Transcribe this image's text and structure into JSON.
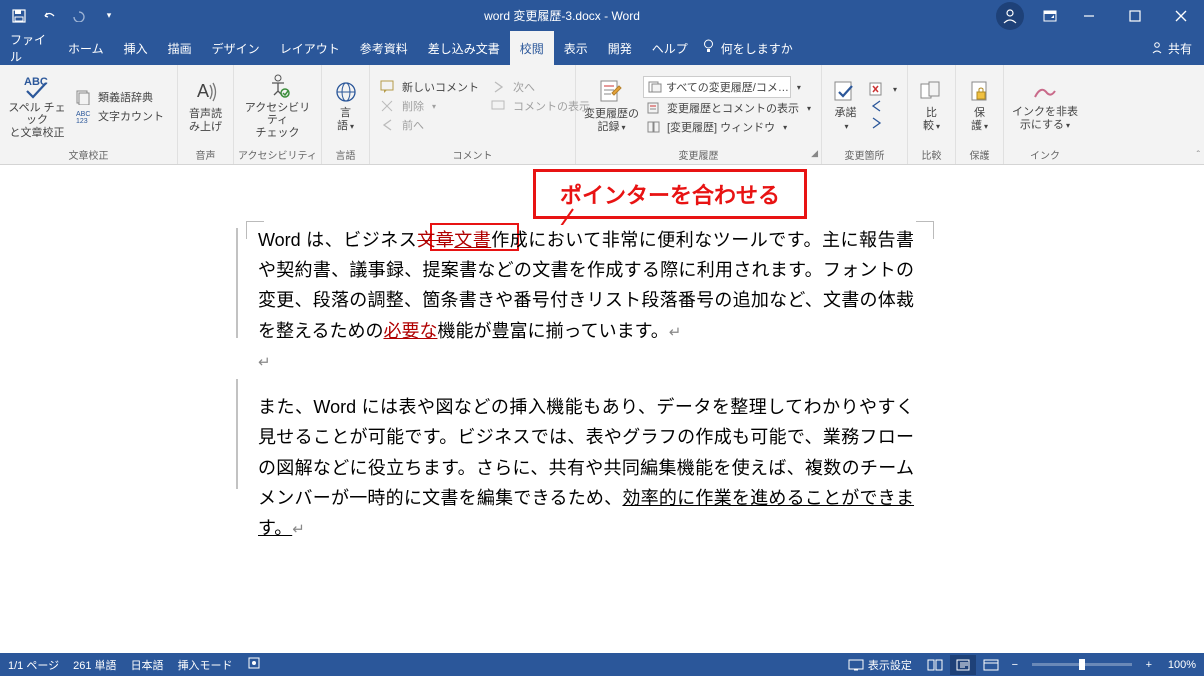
{
  "title": "word 変更履歴-3.docx - Word",
  "qat": {
    "save_icon": "save",
    "undo_icon": "undo",
    "redo_icon": "redo",
    "more_icon": "chevron"
  },
  "tabs": {
    "file": "ファイル",
    "home": "ホーム",
    "insert": "挿入",
    "draw": "描画",
    "design": "デザイン",
    "layout": "レイアウト",
    "references": "参考資料",
    "mailings": "差し込み文書",
    "review": "校閲",
    "view": "表示",
    "developer": "開発",
    "help": "ヘルプ",
    "tellme": "何をしますか"
  },
  "share_label": "共有",
  "ribbon": {
    "proofing": {
      "label": "文章校正",
      "spellcheck": "スペル チェック\nと文章校正",
      "thesaurus": "類義語辞典",
      "wordcount": "文字カウント"
    },
    "speech": {
      "label": "音声",
      "readaloud": "音声読\nみ上げ"
    },
    "accessibility": {
      "label": "アクセシビリティ",
      "check": "アクセシビリティ\nチェック"
    },
    "language": {
      "label": "言語",
      "lang": "言\n語"
    },
    "comments": {
      "label": "コメント",
      "new": "新しいコメント",
      "delete": "削除",
      "previous": "前へ",
      "next": "次へ",
      "show": "コメントの表示"
    },
    "tracking": {
      "label": "変更履歴",
      "track": "変更履歴の\n記録",
      "display": "すべての変更履歴/コメ…",
      "showmarkup": "変更履歴とコメントの表示",
      "pane": "[変更履歴] ウィンドウ"
    },
    "changes": {
      "label": "変更箇所",
      "accept": "承諾"
    },
    "compare": {
      "label": "比較",
      "compare": "比\n較"
    },
    "protect": {
      "label": "保護",
      "protect": "保\n護"
    },
    "ink": {
      "label": "インク",
      "hide": "インクを非表\n示にする"
    }
  },
  "callout": "ポインターを合わせる",
  "document": {
    "p1_pre": "Word は、ビジネス",
    "p1_del": "文章",
    "p1_ins": "文書",
    "p1_mid": "作成において非常に便利なツールです。主に報告書や契約書、議事録、提案書などの文書を作成する際に利用されます。フォントの変更、段落の調整、箇条書きや番号付きリスト段落番号の追加など、文書の体裁を整えるための",
    "p1_ins2": "必要な",
    "p1_post": "機能が豊富に揃っています。",
    "p2_pre": "また、Word には表や図などの挿入機能もあり、データを整理してわかりやすく見せることが可能です。ビジネスでは、表やグラフの作成も可能で、業務フローの図解などに役立ちます。さらに、共有や共同編集機能を使えば、複数のチームメンバーが一時的に文書を編集できるため、",
    "p2_underline": "効率的に作業を進めることができます。"
  },
  "statusbar": {
    "page": "1/1 ページ",
    "words": "261 単語",
    "language": "日本語",
    "mode": "挿入モード",
    "display_settings": "表示設定",
    "zoom": "100%"
  }
}
